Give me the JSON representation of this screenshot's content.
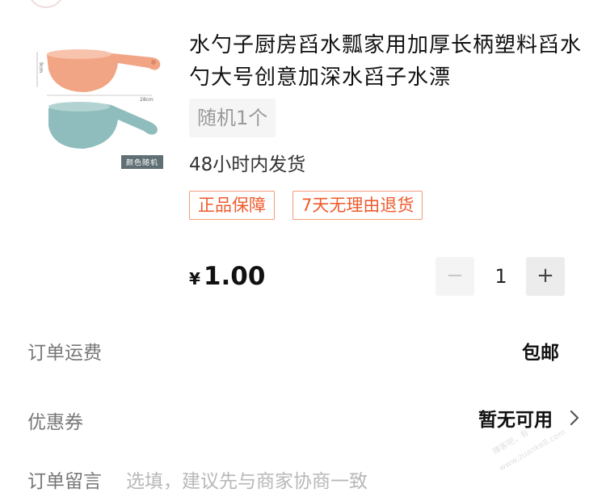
{
  "product": {
    "title": "水勺子厨房舀水瓢家用加厚长柄塑料舀水勺大号创意加深水舀子水漂",
    "image_caption": "颜色随机",
    "image_dimensions": [
      "9cm",
      "28cm"
    ],
    "variant": "随机1个",
    "shipping_note": "48小时内发货",
    "tags": [
      "正品保障",
      "7天无理由退货"
    ],
    "price_symbol": "¥",
    "price": "1.00",
    "quantity": "1",
    "minus_label": "−",
    "plus_label": "+",
    "colors": {
      "ladle_top": "#f2a584",
      "ladle_bottom": "#8fbcbc",
      "tag_border": "#f19a7a",
      "tag_text": "#ef5a2c"
    }
  },
  "order": {
    "shipping_label": "订单运费",
    "shipping_value": "包邮",
    "coupon_label": "优惠券",
    "coupon_value": "暂无可用",
    "note_label": "订单留言",
    "note_placeholder": "选填，建议先与商家协商一致"
  },
  "watermark": {
    "line1": "赚客吧，有",
    "line2": "www.zuanke8.com"
  },
  "icons": {
    "chevron": "chevron-right-icon"
  }
}
